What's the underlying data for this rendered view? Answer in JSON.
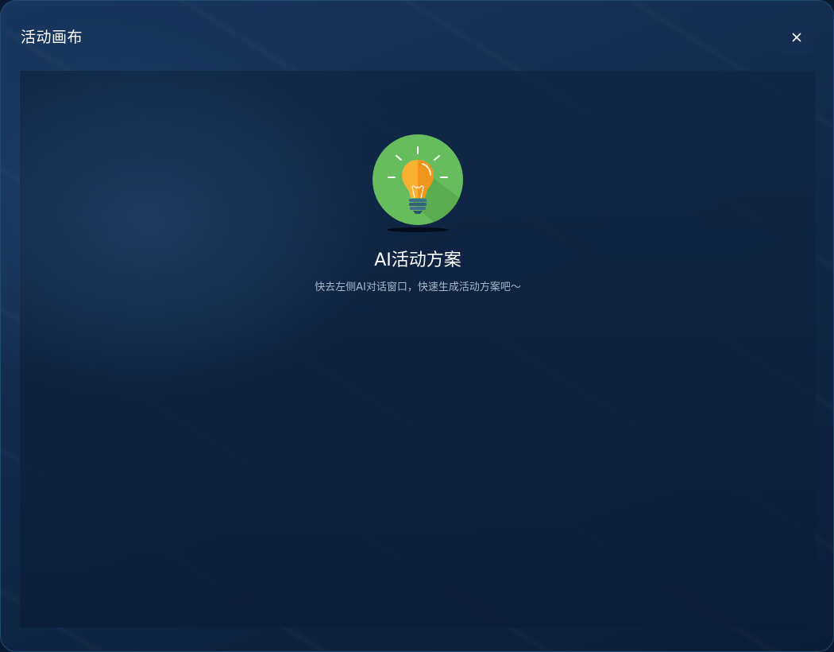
{
  "dialog": {
    "title": "活动画布",
    "close_icon": "close-icon"
  },
  "empty_state": {
    "icon": "lightbulb-icon",
    "title": "AI活动方案",
    "description": "快去左侧AI对话窗口，快速生成活动方案吧～"
  },
  "colors": {
    "background": "#112a4c",
    "canvas": "#0f2240",
    "title_text": "#ffffff",
    "desc_text": "#a9b6c8",
    "icon_circle": "#66bb5a",
    "bulb": "#f6a623"
  }
}
